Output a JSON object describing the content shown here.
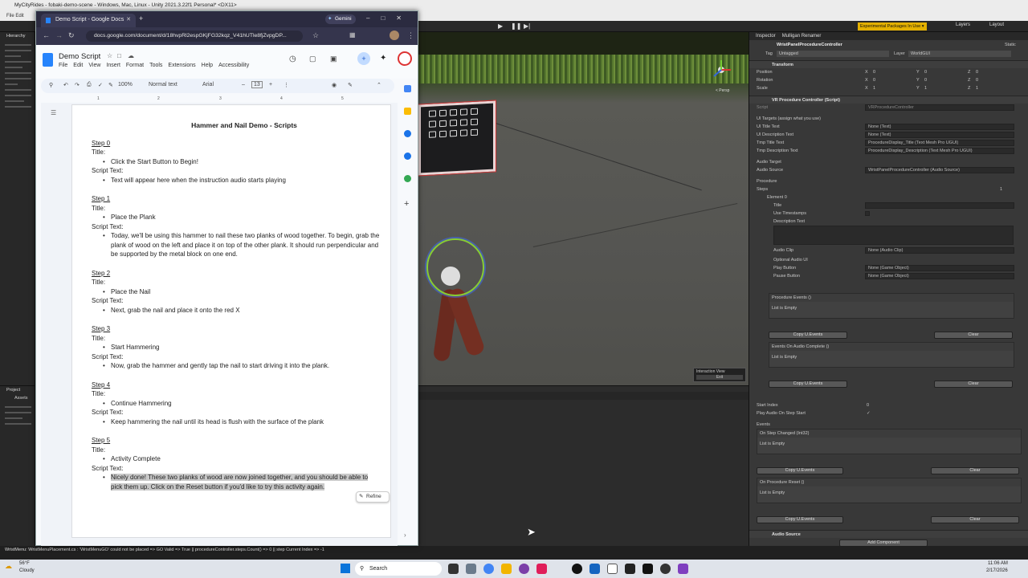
{
  "unity": {
    "title": "MyCityRides - fobaki-demo-scene - Windows, Mac, Linux - Unity 2021.3.22f1 Personal* <DX11>",
    "menu": "File  Edit",
    "experimental": "Experimental Packages In Use ▾",
    "layers": "Layers",
    "layout": "Layout",
    "tabs": [
      "Inspector",
      "Mulligan Renamer"
    ],
    "hierarchy_tab": "Hierarchy",
    "project_tab": "Project",
    "assets_label": "Assets",
    "gameobject_name": "WristPanelProcedureController",
    "static_label": "Static",
    "tag_label": "Tag",
    "tag_value": "Untagged",
    "layer_label": "Layer",
    "layer_value": "WorldGUI",
    "transform": {
      "header": "Transform",
      "rows": [
        {
          "label": "Position",
          "x": "0",
          "y": "0",
          "z": "0"
        },
        {
          "label": "Rotation",
          "x": "0",
          "y": "0",
          "z": "0"
        },
        {
          "label": "Scale",
          "x": "1",
          "y": "1",
          "z": "1"
        }
      ]
    },
    "script_header": "VR Procedure Controller (Script)",
    "script_field": "Script",
    "script_value": "VRProcedureController",
    "ui_targets": "UI Targets (assign what you use)",
    "fields": [
      {
        "label": "UI Title Text",
        "value": "None (Text)"
      },
      {
        "label": "UI Description Text",
        "value": "None (Text)"
      },
      {
        "label": "Tmp Title Text",
        "value": "ProcedureDisplay_Title (Text Mesh Pro UGUI)"
      },
      {
        "label": "Tmp Description Text",
        "value": "ProcedureDisplay_Description (Text Mesh Pro UGUI)"
      }
    ],
    "audio_target": "Audio Target",
    "audio_source_label": "Audio Source",
    "audio_source_value": "WristPanelProcedureController (Audio Source)",
    "procedure": "Procedure",
    "steps_label": "Steps",
    "steps_count": "1",
    "element0": "Element 0",
    "el_title": "Title",
    "use_timestamps": "Use Timestamps",
    "description_text": "Description Text",
    "audio_clip_label": "Audio Clip",
    "audio_clip_value": "None (Audio Clip)",
    "optional_audio": "Optional Audio UI",
    "play_button_label": "Play Button",
    "play_button_value": "None (Game Object)",
    "pause_button_label": "Pause Button",
    "pause_button_value": "None (Game Object)",
    "procedure_events": "Procedure Events ()",
    "list_empty": "List is Empty",
    "copy_events": "Copy U.Events",
    "clear": "Clear",
    "events_audio_complete": "Events On Audio Complete ()",
    "start_index_label": "Start Index",
    "start_index_value": "0",
    "play_audio_label": "Play Audio On Step Start",
    "events": "Events",
    "on_step_changed": "On Step Changed (Int32)",
    "on_procedure_reset": "On Procedure Reset ()",
    "audio_source_comp": "Audio Source",
    "add_component": "Add Component",
    "interaction_view": "Interaction View",
    "exit": "Exit",
    "persp": "< Persp",
    "status": "WristMenu: WristMenuPlacement.cs : 'WristMenuGO' could not be placed => GO Valid => True || procedureController.steps.Count() => 0 || step Current Index => -1"
  },
  "chrome": {
    "tab_title": "Demo Script - Google Docs",
    "gemini": "Gemini",
    "url": "docs.google.com/document/d/18hvpRl2espGKjFG32kqz_V41hUTle8fjZvpgDP..."
  },
  "docs": {
    "title": "Demo Script",
    "menus": [
      "File",
      "Edit",
      "View",
      "Insert",
      "Format",
      "Tools",
      "Extensions",
      "Help",
      "Accessibility"
    ],
    "zoom": "100%",
    "style": "Normal text",
    "font": "Arial",
    "size": "13",
    "heading": "Hammer and Nail Demo - Scripts",
    "title_label": "Title:",
    "script_label": "Script Text:",
    "refine": "Refine",
    "steps": [
      {
        "name": "Step 0",
        "title": "Click the Start Button to Begin!",
        "script": "Text will appear here when the instruction audio starts playing"
      },
      {
        "name": "Step 1",
        "title": "Place the Plank",
        "script": "Today, we'll be using this hammer to nail these two planks of wood together. To begin, grab the plank of wood on the left and place it on top of the other plank. It should run perpendicular and be supported by the metal block on one end."
      },
      {
        "name": "Step 2",
        "title": "Place the Nail",
        "script": "Next, grab the nail and place it onto the red X"
      },
      {
        "name": "Step 3",
        "title": "Start Hammering",
        "script": "Now, grab the hammer and gently tap the nail to start driving it into the plank."
      },
      {
        "name": "Step 4",
        "title": "Continue Hammering",
        "script": "Keep hammering the nail until its head is flush with the surface of the plank"
      },
      {
        "name": "Step 5",
        "title": "Activity Complete",
        "script": "Nicely done! These two planks of wood are now joined together, and you should be able to pick them up. Click on the Reset button if you'd like to try this activity again."
      }
    ]
  },
  "taskbar": {
    "temp": "56°F",
    "weather": "Cloudy",
    "search": "Search",
    "time": "11:06 AM",
    "date": "2/17/2026"
  },
  "colors": {
    "accent": "#2684fc",
    "unity_dark": "#383838",
    "highlight": "#c9c9c9"
  }
}
